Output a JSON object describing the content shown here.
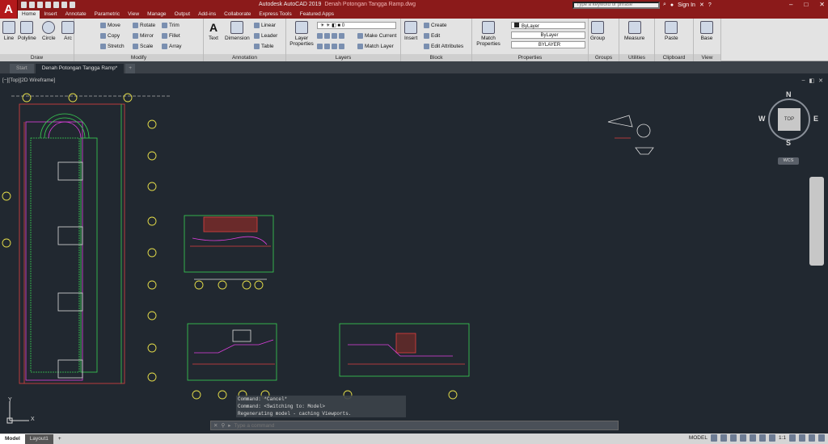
{
  "titlebar": {
    "title": "Autodesk AutoCAD 2019",
    "document": "Denah Potongan Tangga Ramp.dwg",
    "search_placeholder": "Type a keyword or phrase",
    "sign_in": "Sign In"
  },
  "ribbon_tabs": [
    "Home",
    "Insert",
    "Annotate",
    "Parametric",
    "View",
    "Manage",
    "Output",
    "Add-ins",
    "Collaborate",
    "Express Tools",
    "Featured Apps"
  ],
  "panels": {
    "draw": {
      "title": "Draw",
      "tools": [
        "Line",
        "Polyline",
        "Circle",
        "Arc"
      ]
    },
    "modify": {
      "title": "Modify",
      "tools": [
        "Move",
        "Rotate",
        "Trim",
        "Copy",
        "Mirror",
        "Fillet",
        "Stretch",
        "Scale",
        "Array"
      ]
    },
    "annotation": {
      "title": "Annotation",
      "tools": [
        "Text",
        "Dimension",
        "Linear",
        "Leader",
        "Table"
      ]
    },
    "layers": {
      "title": "Layers",
      "layer_props": "Layer Properties",
      "current_layer": "0",
      "make_current": "Make Current",
      "match_layer": "Match Layer"
    },
    "block": {
      "title": "Block",
      "insert": "Insert",
      "create": "Create",
      "edit": "Edit",
      "edit_attributes": "Edit Attributes"
    },
    "properties": {
      "title": "Properties",
      "match": "Match Properties",
      "color": "ByLayer",
      "linetype": "ByLayer",
      "lineweight": "BYLAYER"
    },
    "groups": {
      "title": "Groups",
      "group": "Group"
    },
    "utilities": {
      "title": "Utilities",
      "measure": "Measure"
    },
    "clipboard": {
      "title": "Clipboard",
      "paste": "Paste"
    },
    "view": {
      "title": "View",
      "base": "Base"
    }
  },
  "file_tabs": [
    "Start",
    "Denah Potongan Tangga Ramp*"
  ],
  "viewport": {
    "label": "[−][Top][2D Wireframe]",
    "viewcube": {
      "top": "TOP",
      "n": "N",
      "s": "S",
      "e": "E",
      "w": "W"
    },
    "wcs": "WCS"
  },
  "command_history": [
    "Command: *Cancel*",
    "Command:  <Switching to: Model>",
    "Regenerating model - caching Viewports."
  ],
  "command_placeholder": "Type a command",
  "layout_tabs": [
    "Model",
    "Layout1"
  ],
  "statusbar": {
    "model": "MODEL",
    "scale": "1:1"
  },
  "colors": {
    "title_red": "#8b1a1a",
    "canvas": "#212830",
    "drawing_yellow": "#e8e04a",
    "drawing_green": "#39d353",
    "drawing_magenta": "#e040e0",
    "drawing_red": "#e04040"
  }
}
